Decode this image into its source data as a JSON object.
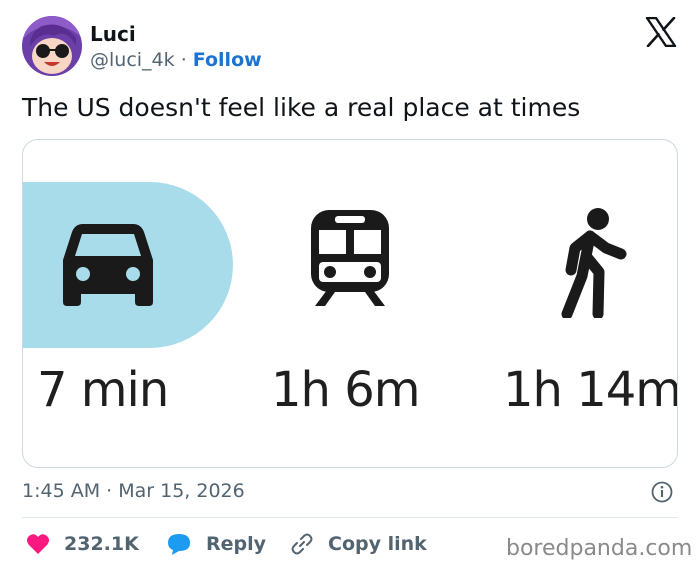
{
  "author": {
    "name": "Luci",
    "handle": "@luci_4k",
    "separator": "·",
    "follow_label": "Follow"
  },
  "tweet": {
    "text": "The US doesn't feel like a real place at times",
    "timestamp": "1:45 AM · Mar 15, 2026"
  },
  "media": {
    "modes": [
      {
        "icon": "car-icon",
        "time": "7 min",
        "selected": true
      },
      {
        "icon": "train-icon",
        "time": "1h 6m",
        "selected": false
      },
      {
        "icon": "walking-person-icon",
        "time": "1h 14m",
        "selected": false
      }
    ],
    "selected_color": "#a8dcea"
  },
  "actions": {
    "like_count": "232.1K",
    "reply_label": "Reply",
    "copy_link_label": "Copy link"
  },
  "colors": {
    "like": "#f91880",
    "reply": "#1d9bf0",
    "follow": "#1d73d1"
  },
  "watermark": "boredpanda.com"
}
